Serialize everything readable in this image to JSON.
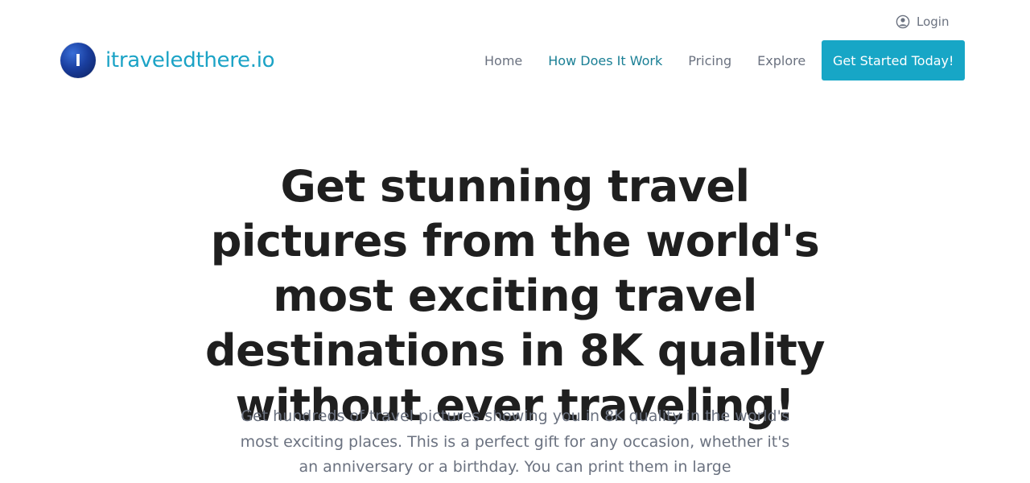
{
  "topbar": {
    "login_label": "Login",
    "login_icon": "user-circle-icon"
  },
  "brand": {
    "logo_letter": "I",
    "name": "itraveledthere.io"
  },
  "nav": {
    "items": [
      {
        "label": "Home",
        "active": false
      },
      {
        "label": "How Does It Work",
        "active": true
      },
      {
        "label": "Pricing",
        "active": false
      },
      {
        "label": "Explore",
        "active": false
      }
    ],
    "cta_label": "Get Started Today!"
  },
  "hero": {
    "title": "Get stunning travel pictures from the world's most exciting travel destinations in 8K quality without ever traveling!",
    "subtitle": "Get hundreds of travel pictures showing you in 8K quality in the world's most exciting places. This is a perfect gift for any occasion, whether it's an anniversary or a birthday. You can print them in large"
  },
  "colors": {
    "accent": "#17a6c6",
    "brand_text": "#1ba3c6",
    "nav_active": "#1a7f95",
    "muted_text": "#6b7280",
    "heading_text": "#1f1f1f"
  }
}
